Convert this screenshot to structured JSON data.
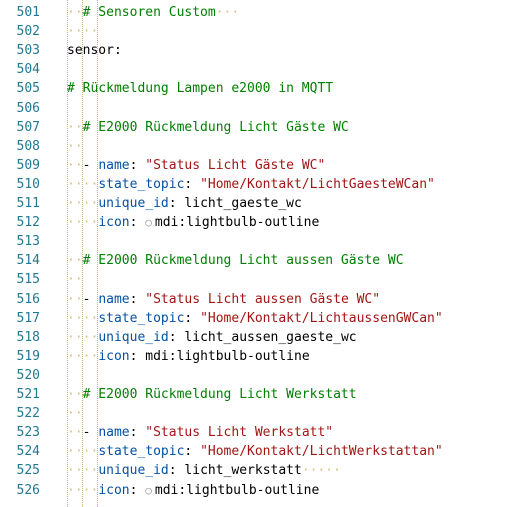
{
  "colors": {
    "line_number": "#237893",
    "comment": "#008000",
    "key": "#0451a5",
    "string": "#a31515",
    "whitespace_dots": "#d4c089",
    "background": "#ffffff"
  },
  "lines": [
    {
      "num": "501",
      "parts": [
        {
          "t": "ws",
          "text": "··"
        },
        {
          "t": "cmt",
          "text": "# Sensoren Custom"
        },
        {
          "t": "ws",
          "text": "···"
        }
      ]
    },
    {
      "num": "502",
      "parts": [
        {
          "t": "ws",
          "text": "····"
        }
      ]
    },
    {
      "num": "503",
      "parts": [
        {
          "t": "plain",
          "text": "sensor:"
        }
      ]
    },
    {
      "num": "504",
      "parts": []
    },
    {
      "num": "505",
      "parts": [
        {
          "t": "cmt",
          "text": "# Rückmeldung Lampen e2000 in MQTT"
        }
      ]
    },
    {
      "num": "506",
      "parts": []
    },
    {
      "num": "507",
      "parts": [
        {
          "t": "ws",
          "text": "··"
        },
        {
          "t": "cmt",
          "text": "# E2000 Rückmeldung Licht Gäste WC"
        }
      ]
    },
    {
      "num": "508",
      "parts": [
        {
          "t": "ws",
          "text": "··"
        }
      ]
    },
    {
      "num": "509",
      "parts": [
        {
          "t": "ws",
          "text": "··"
        },
        {
          "t": "dash",
          "text": "- "
        },
        {
          "t": "key",
          "text": "name"
        },
        {
          "t": "plain",
          "text": ": "
        },
        {
          "t": "str",
          "text": "\"Status Licht Gäste WC\""
        }
      ]
    },
    {
      "num": "510",
      "parts": [
        {
          "t": "ws",
          "text": "····"
        },
        {
          "t": "key",
          "text": "state_topic"
        },
        {
          "t": "plain",
          "text": ": "
        },
        {
          "t": "str",
          "text": "\"Home/Kontakt/LichtGaesteWCan\""
        }
      ]
    },
    {
      "num": "511",
      "parts": [
        {
          "t": "ws",
          "text": "····"
        },
        {
          "t": "key",
          "text": "unique_id"
        },
        {
          "t": "plain",
          "text": ": "
        },
        {
          "t": "plain",
          "text": "licht_gaeste_wc"
        }
      ]
    },
    {
      "num": "512",
      "parts": [
        {
          "t": "ws",
          "text": "····"
        },
        {
          "t": "key",
          "text": "icon"
        },
        {
          "t": "plain",
          "text": ": "
        },
        {
          "t": "bulb",
          "text": "○"
        },
        {
          "t": "plain",
          "text": "mdi:lightbulb-outline"
        }
      ]
    },
    {
      "num": "513",
      "parts": []
    },
    {
      "num": "514",
      "parts": [
        {
          "t": "ws",
          "text": "··"
        },
        {
          "t": "cmt",
          "text": "# E2000 Rückmeldung Licht aussen Gäste WC"
        }
      ]
    },
    {
      "num": "515",
      "parts": [
        {
          "t": "ws",
          "text": "··"
        }
      ]
    },
    {
      "num": "516",
      "parts": [
        {
          "t": "ws",
          "text": "··"
        },
        {
          "t": "dash",
          "text": "- "
        },
        {
          "t": "key",
          "text": "name"
        },
        {
          "t": "plain",
          "text": ": "
        },
        {
          "t": "str",
          "text": "\"Status Licht aussen Gäste WC\""
        }
      ]
    },
    {
      "num": "517",
      "parts": [
        {
          "t": "ws",
          "text": "····"
        },
        {
          "t": "key",
          "text": "state_topic"
        },
        {
          "t": "plain",
          "text": ": "
        },
        {
          "t": "str",
          "text": "\"Home/Kontakt/LichtaussenGWCan\""
        }
      ]
    },
    {
      "num": "518",
      "parts": [
        {
          "t": "ws",
          "text": "····"
        },
        {
          "t": "key",
          "text": "unique_id"
        },
        {
          "t": "plain",
          "text": ": "
        },
        {
          "t": "plain",
          "text": "licht_aussen_gaeste_wc"
        }
      ]
    },
    {
      "num": "519",
      "parts": [
        {
          "t": "ws",
          "text": "····"
        },
        {
          "t": "key",
          "text": "icon"
        },
        {
          "t": "plain",
          "text": ": "
        },
        {
          "t": "plain",
          "text": "mdi:lightbulb-outline"
        }
      ]
    },
    {
      "num": "520",
      "parts": []
    },
    {
      "num": "521",
      "parts": [
        {
          "t": "ws",
          "text": "··"
        },
        {
          "t": "cmt",
          "text": "# E2000 Rückmeldung Licht Werkstatt"
        }
      ]
    },
    {
      "num": "522",
      "parts": [
        {
          "t": "ws",
          "text": "··"
        }
      ]
    },
    {
      "num": "523",
      "parts": [
        {
          "t": "ws",
          "text": "··"
        },
        {
          "t": "dash",
          "text": "- "
        },
        {
          "t": "key",
          "text": "name"
        },
        {
          "t": "plain",
          "text": ": "
        },
        {
          "t": "str",
          "text": "\"Status Licht Werkstatt\""
        }
      ]
    },
    {
      "num": "524",
      "parts": [
        {
          "t": "ws",
          "text": "····"
        },
        {
          "t": "key",
          "text": "state_topic"
        },
        {
          "t": "plain",
          "text": ": "
        },
        {
          "t": "str",
          "text": "\"Home/Kontakt/LichtWerkstattan\""
        }
      ]
    },
    {
      "num": "525",
      "parts": [
        {
          "t": "ws",
          "text": "····"
        },
        {
          "t": "key",
          "text": "unique_id"
        },
        {
          "t": "plain",
          "text": ": "
        },
        {
          "t": "plain",
          "text": "licht_werkstatt"
        },
        {
          "t": "ws",
          "text": "·····"
        }
      ]
    },
    {
      "num": "526",
      "parts": [
        {
          "t": "ws",
          "text": "····"
        },
        {
          "t": "key",
          "text": "icon"
        },
        {
          "t": "plain",
          "text": ": "
        },
        {
          "t": "bulb",
          "text": "○"
        },
        {
          "t": "plain",
          "text": "mdi:lightbulb-outline"
        }
      ]
    }
  ]
}
